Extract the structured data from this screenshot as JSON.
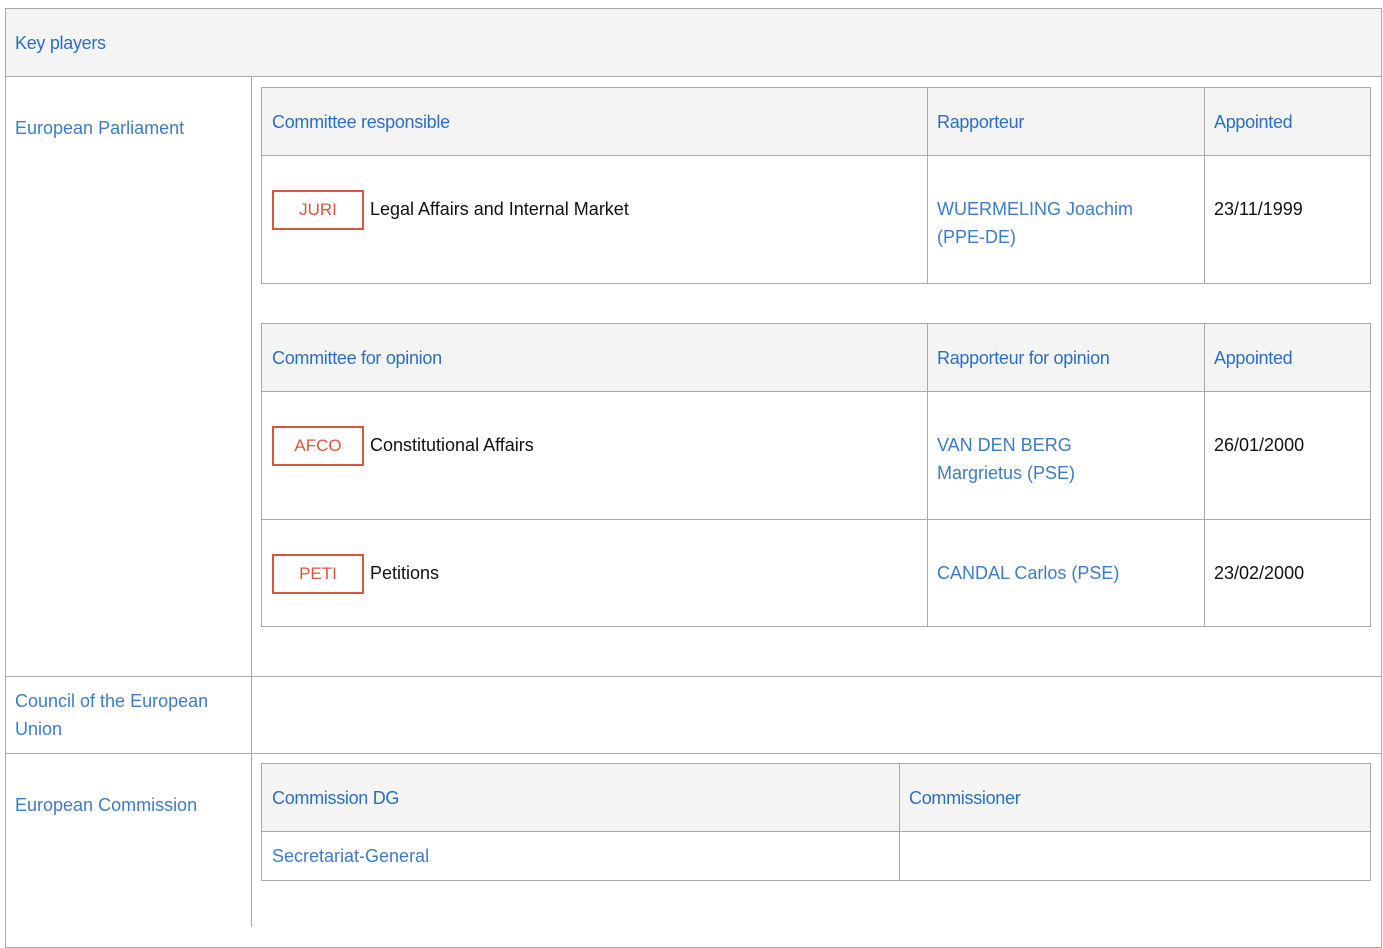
{
  "section": {
    "title": "Key players"
  },
  "ep": {
    "label": "European Parliament",
    "responsible": {
      "headers": {
        "committee": "Committee responsible",
        "rapporteur": "Rapporteur",
        "appointed": "Appointed"
      },
      "rows": [
        {
          "code": "JURI",
          "name": "Legal Affairs and Internal Market",
          "rapporteur_line1": "WUERMELING Joachim",
          "rapporteur_line2": "(PPE-DE)",
          "date": "23/11/1999"
        }
      ]
    },
    "opinion": {
      "headers": {
        "committee": "Committee for opinion",
        "rapporteur": "Rapporteur for opinion",
        "appointed": "Appointed"
      },
      "rows": [
        {
          "code": "AFCO",
          "name": "Constitutional Affairs",
          "rapporteur_line1": "VAN DEN BERG",
          "rapporteur_line2": "Margrietus (PSE)",
          "date": "26/01/2000"
        },
        {
          "code": "PETI",
          "name": "Petitions",
          "rapporteur_line1": "CANDAL Carlos (PSE)",
          "date": "23/02/2000"
        }
      ]
    }
  },
  "council": {
    "label_line1": "Council of the European",
    "label_line2": "Union"
  },
  "commission": {
    "label": "European Commission",
    "headers": {
      "dg": "Commission DG",
      "commissioner": "Commissioner"
    },
    "rows": [
      {
        "dg": "Secretariat-General",
        "commissioner": ""
      }
    ]
  },
  "colors": {
    "link": "#3d7cc4",
    "header_text": "#2b6fc2",
    "badge": "#d9553f",
    "border": "#a9a9a9",
    "header_bg": "#f4f4f4"
  }
}
